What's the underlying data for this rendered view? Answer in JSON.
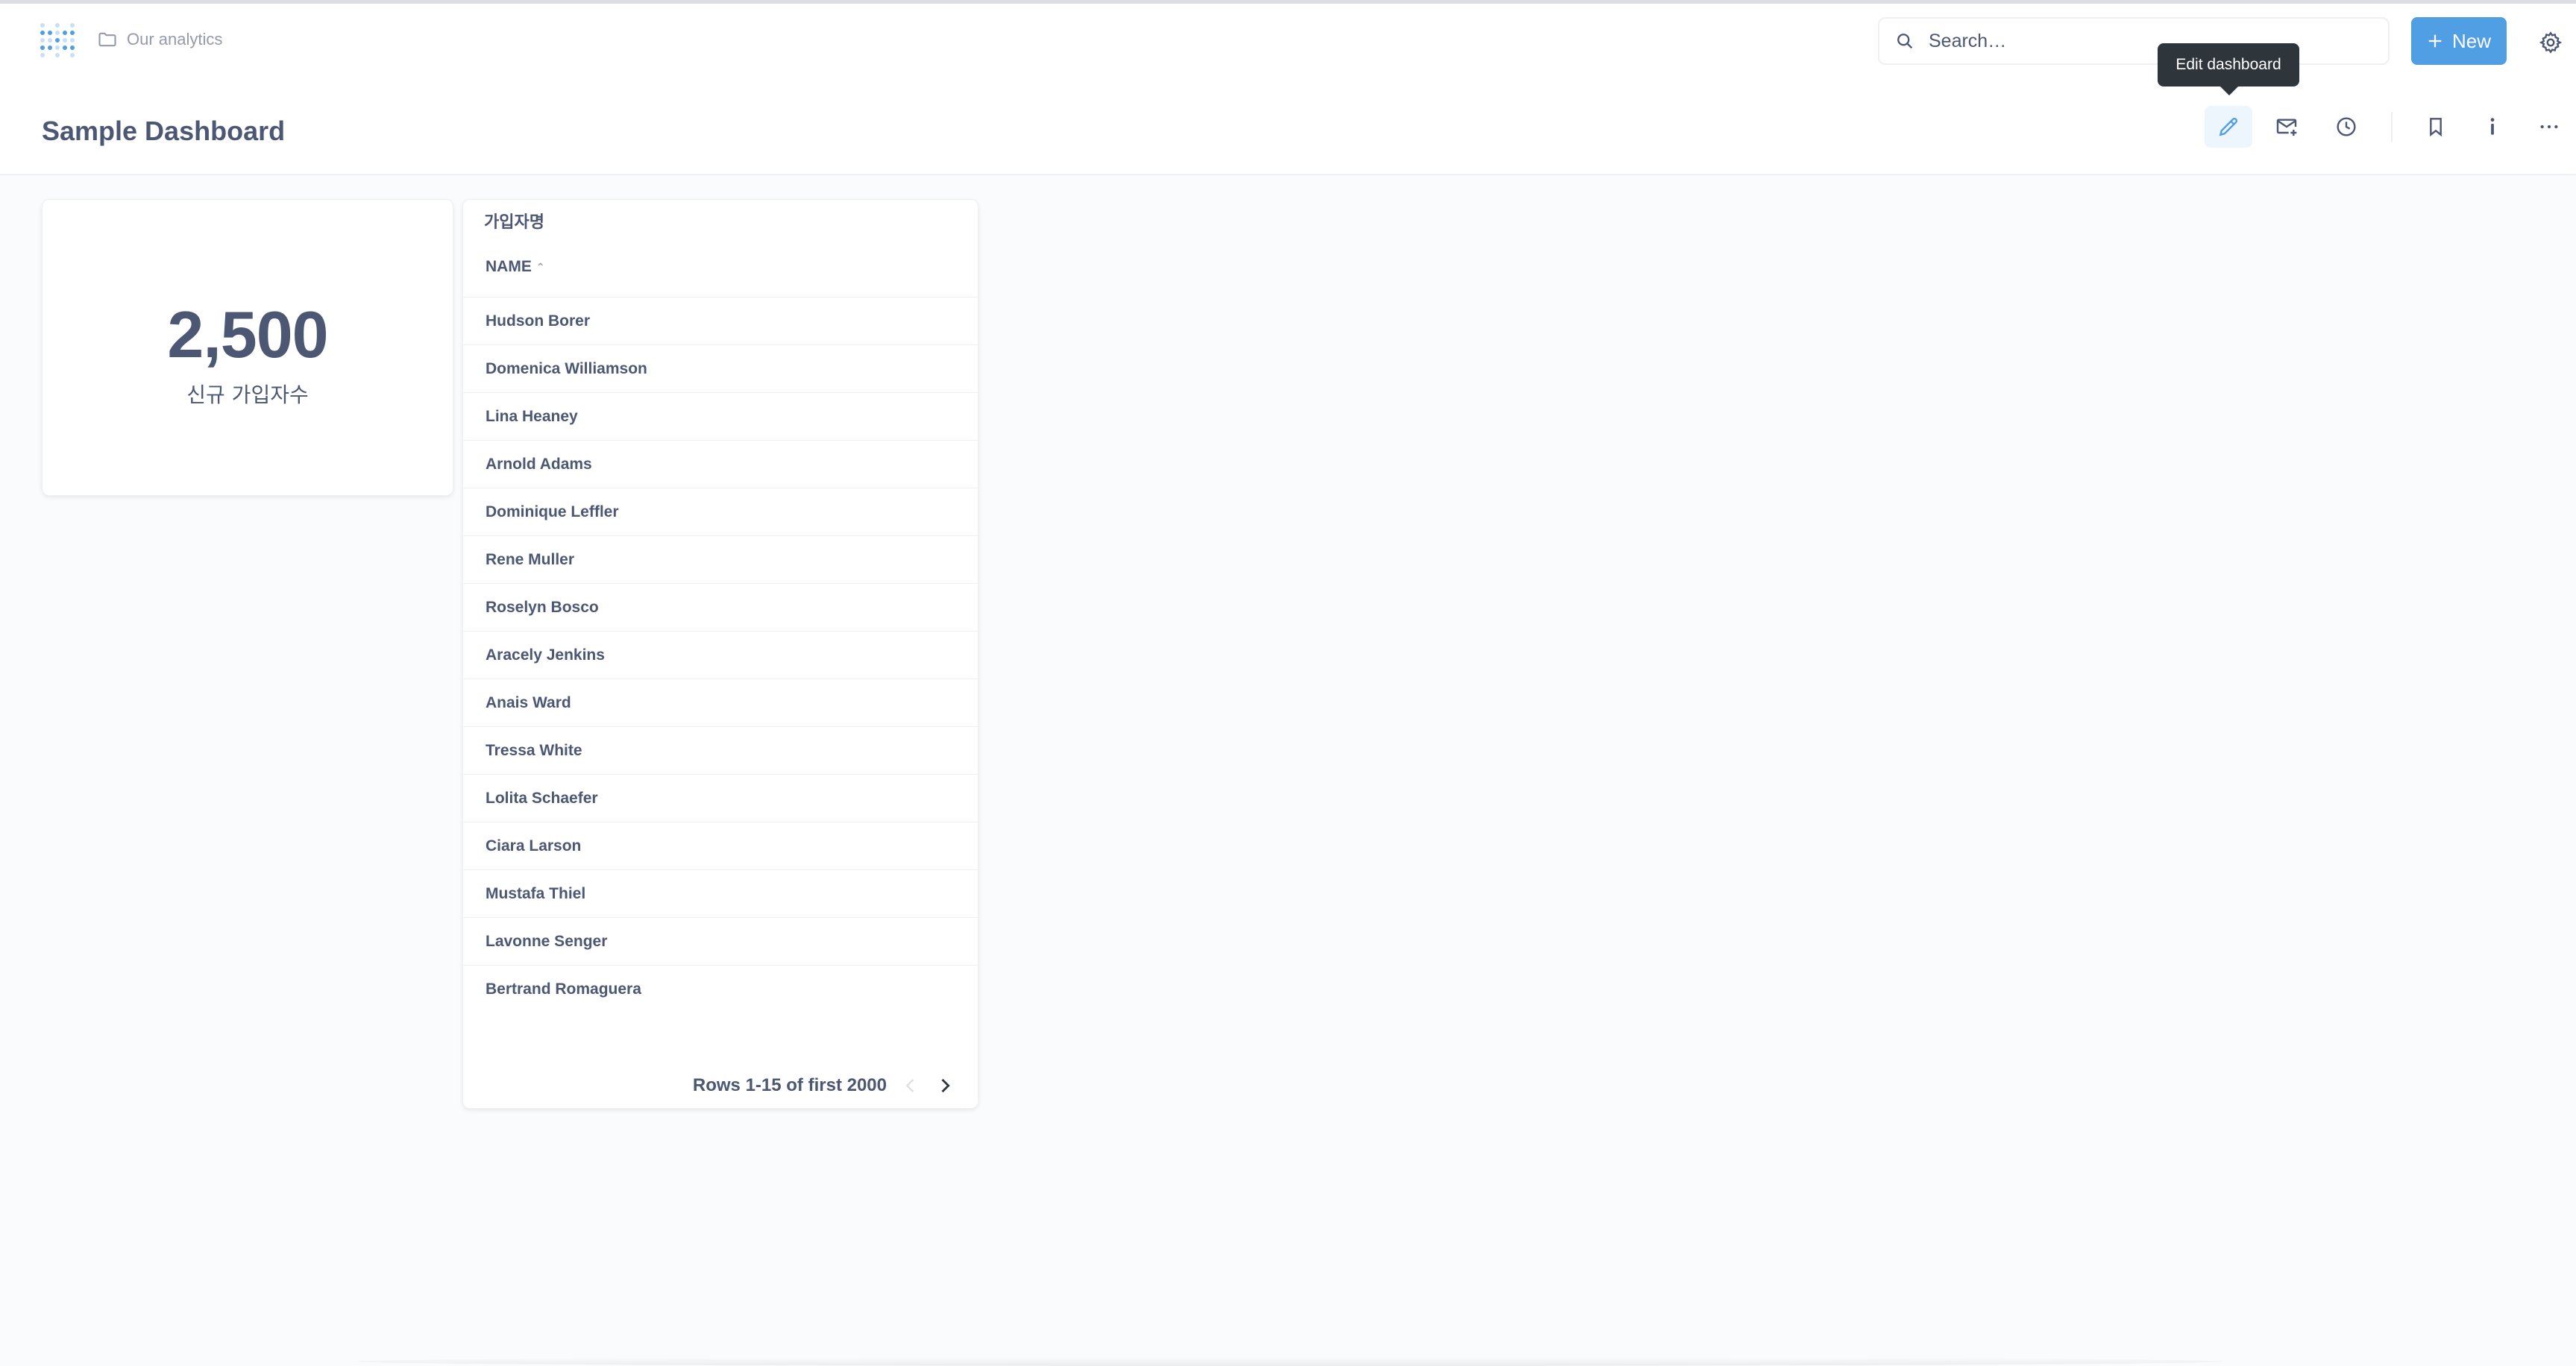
{
  "appbar": {
    "breadcrumb": "Our analytics",
    "search_placeholder": "Search…",
    "new_label": "New"
  },
  "dashboard": {
    "title": "Sample Dashboard",
    "tooltip": "Edit dashboard"
  },
  "scalar_card": {
    "value": "2,500",
    "label": "신규 가입자수"
  },
  "table_card": {
    "title": "가입자명",
    "column": "NAME",
    "rows": [
      "Hudson Borer",
      "Domenica Williamson",
      "Lina Heaney",
      "Arnold Adams",
      "Dominique Leffler",
      "Rene Muller",
      "Roselyn Bosco",
      "Aracely Jenkins",
      "Anais Ward",
      "Tressa White",
      "Lolita Schaefer",
      "Ciara Larson",
      "Mustafa Thiel",
      "Lavonne Senger",
      "Bertrand Romaguera"
    ],
    "pagination": "Rows 1-15 of first 2000"
  },
  "colors": {
    "brand": "#509EE3",
    "text": "#4C5773",
    "muted": "#949AAB",
    "tooltip_bg": "#2E353B"
  }
}
